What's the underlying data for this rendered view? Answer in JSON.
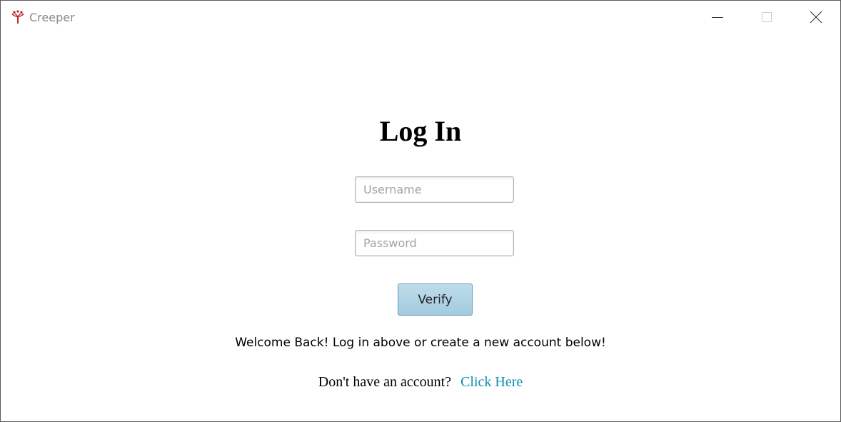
{
  "window": {
    "title": "Creeper",
    "icon": "creeper-logo-icon"
  },
  "window_controls": {
    "minimize_icon": "minimize-icon",
    "maximize_icon": "maximize-icon",
    "close_icon": "close-icon"
  },
  "login": {
    "heading": "Log In",
    "username_placeholder": "Username",
    "username_value": "",
    "password_placeholder": "Password",
    "password_value": "",
    "verify_label": "Verify",
    "welcome_text": "Welcome Back! Log in above or create a new account below!",
    "signup_prompt": "Don't have an account?",
    "signup_link": "Click Here"
  },
  "colors": {
    "link": "#0f8fb3",
    "button_fill": "#a8cfe3",
    "button_border": "#6a9bb4",
    "logo_red": "#c0282e"
  }
}
